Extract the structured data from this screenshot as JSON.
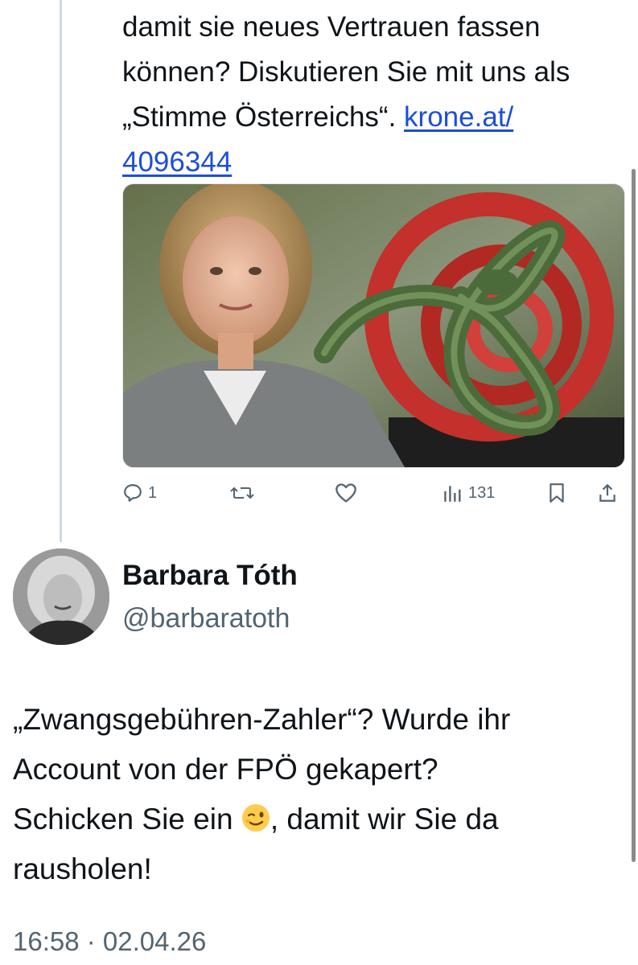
{
  "quoted_tweet": {
    "text_line1": "damit sie neues Vertrauen fassen",
    "text_line2": "können? Diskutieren Sie mit uns als",
    "text_line3_prefix": "„Stimme Österreichs“. ",
    "link_part1": "krone.at/",
    "link_part2": "4096344",
    "media_description": "news-image-woman-with-red-logo-and-snake",
    "actions": {
      "reply_count": "1",
      "views_count": "131"
    }
  },
  "author": {
    "display_name": "Barbara Tóth",
    "handle": "@barbaratoth"
  },
  "tweet": {
    "text_line1": "„Zwangsgebühren-Zahler“? Wurde ihr",
    "text_line2": "Account von der FPÖ gekapert?",
    "text_line3_before_emoji": "Schicken Sie ein ",
    "emoji": "winking-face-emoji",
    "text_line3_after_emoji": ", damit wir Sie da",
    "text_line4": "rausholen!",
    "timestamp": "16:58 · 02.04.26"
  },
  "colors": {
    "link": "#1d4ed8",
    "secondary_text": "#536471",
    "thread_line": "#cfd9de"
  }
}
